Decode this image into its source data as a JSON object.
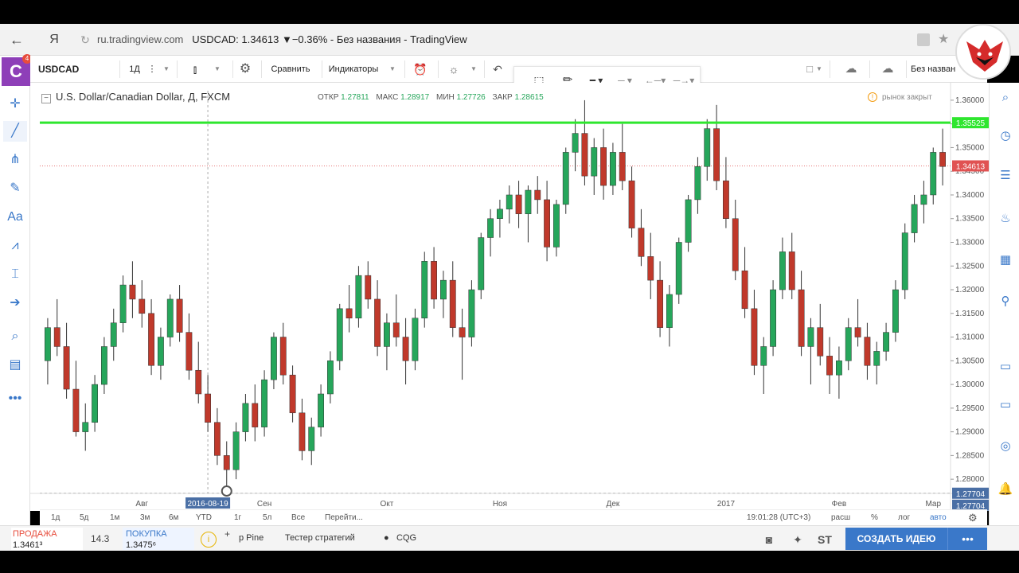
{
  "browser": {
    "url_host": "ru.tradingview.com",
    "page_title": "USDCAD: 1.34613 ▼−0.36% - Без названия - TradingView"
  },
  "leftbar": {
    "brand_letter": "C",
    "badge_count": "4"
  },
  "toolbar": {
    "symbol": "USDCAD",
    "interval": "1Д",
    "compare": "Сравнить",
    "indicators": "Индикаторы",
    "layout_name": "Без назван"
  },
  "legend": {
    "title": "U.S. Dollar/Canadian Dollar, Д, FXCM",
    "open_label": "ОТКР",
    "open_value": "1.27811",
    "high_label": "МАКС",
    "high_value": "1.28917",
    "low_label": "МИН",
    "low_value": "1.27726",
    "close_label": "ЗАКР",
    "close_value": "1.28615",
    "market_status": "рынок закрыт"
  },
  "chart_data": {
    "type": "candlestick",
    "title": "U.S. Dollar/Canadian Dollar, Д, FXCM",
    "y_ticks": [
      "1.36000",
      "1.35500",
      "1.35000",
      "1.34500",
      "1.34000",
      "1.33500",
      "1.33000",
      "1.32500",
      "1.32000",
      "1.31500",
      "1.31000",
      "1.30500",
      "1.30000",
      "1.29500",
      "1.29000",
      "1.28500",
      "1.28000"
    ],
    "x_ticks": [
      "Авг",
      "2016-08-19",
      "Сен",
      "Окт",
      "Ноя",
      "Дек",
      "2017",
      "Фев",
      "Мар"
    ],
    "ylim": [
      1.277,
      1.362
    ],
    "price_labels": {
      "resistance": "1.35525",
      "last": "1.34613",
      "cursor_a": "1.27704",
      "cursor_b": "1.27704"
    },
    "resistance_level": 1.35525,
    "last_price": 1.34613,
    "up_color": "#26a65b",
    "down_color": "#c0392b",
    "line_color": "#2ee62e",
    "candles": [
      [
        1.305,
        1.314,
        1.3,
        1.312
      ],
      [
        1.312,
        1.318,
        1.306,
        1.308
      ],
      [
        1.308,
        1.313,
        1.297,
        1.299
      ],
      [
        1.299,
        1.305,
        1.289,
        1.29
      ],
      [
        1.29,
        1.296,
        1.286,
        1.292
      ],
      [
        1.292,
        1.302,
        1.29,
        1.3
      ],
      [
        1.3,
        1.31,
        1.298,
        1.308
      ],
      [
        1.308,
        1.316,
        1.305,
        1.313
      ],
      [
        1.313,
        1.323,
        1.311,
        1.321
      ],
      [
        1.321,
        1.326,
        1.314,
        1.318
      ],
      [
        1.318,
        1.322,
        1.312,
        1.315
      ],
      [
        1.315,
        1.318,
        1.302,
        1.304
      ],
      [
        1.304,
        1.312,
        1.301,
        1.31
      ],
      [
        1.31,
        1.319,
        1.308,
        1.318
      ],
      [
        1.318,
        1.321,
        1.309,
        1.311
      ],
      [
        1.311,
        1.315,
        1.301,
        1.303
      ],
      [
        1.303,
        1.309,
        1.296,
        1.298
      ],
      [
        1.298,
        1.302,
        1.29,
        1.292
      ],
      [
        1.292,
        1.295,
        1.283,
        1.285
      ],
      [
        1.285,
        1.288,
        1.278,
        1.282
      ],
      [
        1.282,
        1.292,
        1.28,
        1.29
      ],
      [
        1.29,
        1.298,
        1.288,
        1.296
      ],
      [
        1.296,
        1.3,
        1.288,
        1.291
      ],
      [
        1.291,
        1.303,
        1.289,
        1.301
      ],
      [
        1.301,
        1.311,
        1.299,
        1.31
      ],
      [
        1.31,
        1.313,
        1.3,
        1.302
      ],
      [
        1.302,
        1.304,
        1.292,
        1.294
      ],
      [
        1.294,
        1.297,
        1.284,
        1.286
      ],
      [
        1.286,
        1.293,
        1.283,
        1.291
      ],
      [
        1.291,
        1.3,
        1.289,
        1.298
      ],
      [
        1.298,
        1.307,
        1.296,
        1.305
      ],
      [
        1.305,
        1.317,
        1.303,
        1.316
      ],
      [
        1.316,
        1.321,
        1.311,
        1.314
      ],
      [
        1.314,
        1.325,
        1.312,
        1.323
      ],
      [
        1.323,
        1.326,
        1.316,
        1.318
      ],
      [
        1.318,
        1.322,
        1.306,
        1.308
      ],
      [
        1.308,
        1.315,
        1.303,
        1.313
      ],
      [
        1.313,
        1.319,
        1.308,
        1.31
      ],
      [
        1.31,
        1.314,
        1.3,
        1.305
      ],
      [
        1.305,
        1.316,
        1.303,
        1.314
      ],
      [
        1.314,
        1.328,
        1.312,
        1.326
      ],
      [
        1.326,
        1.329,
        1.316,
        1.318
      ],
      [
        1.318,
        1.324,
        1.314,
        1.322
      ],
      [
        1.322,
        1.326,
        1.31,
        1.312
      ],
      [
        1.312,
        1.316,
        1.301,
        1.31
      ],
      [
        1.31,
        1.322,
        1.308,
        1.32
      ],
      [
        1.32,
        1.332,
        1.318,
        1.331
      ],
      [
        1.331,
        1.337,
        1.327,
        1.335
      ],
      [
        1.335,
        1.339,
        1.331,
        1.337
      ],
      [
        1.337,
        1.342,
        1.334,
        1.34
      ],
      [
        1.34,
        1.343,
        1.333,
        1.336
      ],
      [
        1.336,
        1.342,
        1.33,
        1.341
      ],
      [
        1.341,
        1.344,
        1.336,
        1.339
      ],
      [
        1.339,
        1.343,
        1.326,
        1.329
      ],
      [
        1.329,
        1.339,
        1.327,
        1.338
      ],
      [
        1.338,
        1.35,
        1.336,
        1.349
      ],
      [
        1.349,
        1.356,
        1.345,
        1.353
      ],
      [
        1.353,
        1.36,
        1.342,
        1.344
      ],
      [
        1.344,
        1.352,
        1.34,
        1.35
      ],
      [
        1.35,
        1.354,
        1.339,
        1.342
      ],
      [
        1.342,
        1.351,
        1.34,
        1.349
      ],
      [
        1.349,
        1.355,
        1.341,
        1.343
      ],
      [
        1.343,
        1.346,
        1.331,
        1.333
      ],
      [
        1.333,
        1.337,
        1.325,
        1.327
      ],
      [
        1.327,
        1.332,
        1.318,
        1.322
      ],
      [
        1.322,
        1.326,
        1.31,
        1.312
      ],
      [
        1.312,
        1.321,
        1.308,
        1.319
      ],
      [
        1.319,
        1.331,
        1.317,
        1.33
      ],
      [
        1.33,
        1.34,
        1.328,
        1.339
      ],
      [
        1.339,
        1.348,
        1.336,
        1.346
      ],
      [
        1.346,
        1.356,
        1.343,
        1.354
      ],
      [
        1.354,
        1.359,
        1.341,
        1.343
      ],
      [
        1.343,
        1.348,
        1.333,
        1.335
      ],
      [
        1.335,
        1.339,
        1.322,
        1.324
      ],
      [
        1.324,
        1.329,
        1.314,
        1.316
      ],
      [
        1.316,
        1.32,
        1.302,
        1.304
      ],
      [
        1.304,
        1.31,
        1.298,
        1.308
      ],
      [
        1.308,
        1.322,
        1.306,
        1.32
      ],
      [
        1.32,
        1.331,
        1.318,
        1.328
      ],
      [
        1.328,
        1.332,
        1.318,
        1.32
      ],
      [
        1.32,
        1.324,
        1.306,
        1.308
      ],
      [
        1.308,
        1.314,
        1.3,
        1.312
      ],
      [
        1.312,
        1.317,
        1.304,
        1.306
      ],
      [
        1.306,
        1.31,
        1.298,
        1.302
      ],
      [
        1.302,
        1.308,
        1.297,
        1.305
      ],
      [
        1.305,
        1.314,
        1.303,
        1.312
      ],
      [
        1.312,
        1.318,
        1.308,
        1.31
      ],
      [
        1.31,
        1.313,
        1.301,
        1.304
      ],
      [
        1.304,
        1.309,
        1.3,
        1.307
      ],
      [
        1.307,
        1.313,
        1.305,
        1.311
      ],
      [
        1.311,
        1.322,
        1.309,
        1.32
      ],
      [
        1.32,
        1.334,
        1.318,
        1.332
      ],
      [
        1.332,
        1.34,
        1.33,
        1.338
      ],
      [
        1.338,
        1.343,
        1.334,
        1.34
      ],
      [
        1.34,
        1.35,
        1.338,
        1.349
      ],
      [
        1.349,
        1.354,
        1.342,
        1.346
      ]
    ]
  },
  "timebar": {
    "ranges": [
      "1д",
      "5д",
      "1м",
      "3м",
      "6м",
      "YTD",
      "1г",
      "5л",
      "Все"
    ],
    "goto": "Перейти...",
    "clock": "19:01:28 (UTC+3)",
    "ext": "расш",
    "pct": "%",
    "log": "лог",
    "auto": "авто"
  },
  "bottom": {
    "sell_label": "ПРОДАЖА",
    "sell_value": "1.3461³",
    "spread": "14.3",
    "buy_label": "ПОКУПКА",
    "buy_value": "1.3475⁶",
    "tab_pine": "р Pine",
    "tab_tester": "Тестер стратегий",
    "tab_cqg": "CQG",
    "idea_button": "СОЗДАТЬ ИДЕЮ"
  }
}
